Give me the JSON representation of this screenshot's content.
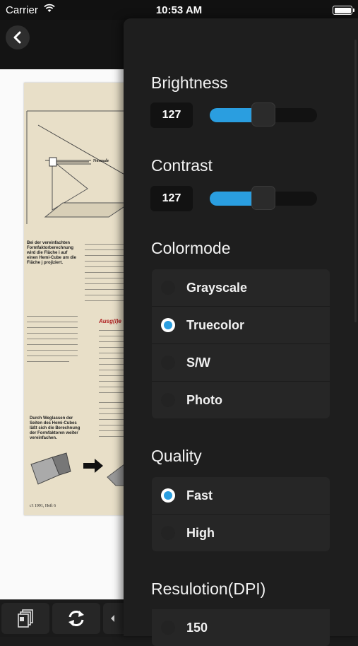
{
  "status_bar": {
    "carrier": "Carrier",
    "time": "10:53 AM"
  },
  "settings": {
    "brightness": {
      "title": "Brightness",
      "value": "127",
      "fraction": 0.5
    },
    "contrast": {
      "title": "Contrast",
      "value": "127",
      "fraction": 0.5
    },
    "colormode": {
      "title": "Colormode",
      "options": [
        "Grayscale",
        "Truecolor",
        "S/W",
        "Photo"
      ],
      "selected": "Truecolor"
    },
    "quality": {
      "title": "Quality",
      "options": [
        "Fast",
        "High"
      ],
      "selected": "Fast"
    },
    "resolution": {
      "title": "Resulotion(DPI)",
      "options": [
        "150"
      ]
    }
  },
  "document": {
    "scan_text": {
      "normale": "Normale",
      "caption1": "Bei der vereinfachten Formfaktorberechnung wird die Fläche i auf einen Hemi-Cube um die Fläche j projiziert.",
      "caption2": "Durch Weglassen der Seiten des Hemi-Cubes läßt sich die Berechnung der Formfaktoren weiter vereinfachen.",
      "heading": "Ausg(l)e",
      "footer": "c't 1991, Heft 6"
    }
  },
  "accent_color": "#2a9ee0",
  "icons": {
    "back": "chevron-left-icon",
    "pages": "pages-icon",
    "rotate": "rotate-icon",
    "wifi": "wifi-icon",
    "battery": "battery-icon"
  }
}
